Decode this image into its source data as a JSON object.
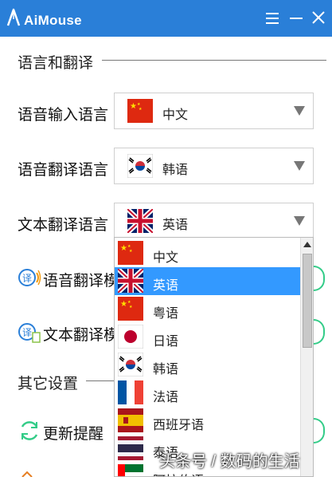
{
  "app": {
    "title": "AiMouse"
  },
  "colors": {
    "titlebar": "#2a7fd8",
    "selected": "#3399ff",
    "toggle": "#33cc88"
  },
  "titlebar": {
    "menu_icon": "hamburger-menu-icon",
    "minimize_icon": "minimize-icon",
    "close_icon": "close-icon"
  },
  "sections": {
    "language": {
      "title": "语言和翻译"
    },
    "other": {
      "title": "其它设置"
    }
  },
  "settings": {
    "voice_input": {
      "label": "语音输入语言",
      "value": "中文",
      "flag": "cn-flag-icon"
    },
    "voice_translate": {
      "label": "语音翻译语言",
      "value": "韩语",
      "flag": "kr-flag-icon"
    },
    "text_translate": {
      "label": "文本翻译语言",
      "value": "英语",
      "flag": "uk-flag-icon"
    },
    "voice_translate_mode": {
      "label": "语音翻译模式",
      "icon": "voice-translate-icon"
    },
    "text_translate_mode": {
      "label": "文本翻译模式",
      "icon": "text-translate-icon"
    },
    "update_reminder": {
      "label": "更新提醒",
      "icon": "refresh-icon"
    }
  },
  "dropdown": {
    "selected_index": 1,
    "items": [
      {
        "label": "中文",
        "flag": "cn-flag-icon"
      },
      {
        "label": "英语",
        "flag": "uk-flag-icon"
      },
      {
        "label": "粤语",
        "flag": "cn-flag-icon"
      },
      {
        "label": "日语",
        "flag": "jp-flag-icon"
      },
      {
        "label": "韩语",
        "flag": "kr-flag-icon"
      },
      {
        "label": "法语",
        "flag": "fr-flag-icon"
      },
      {
        "label": "西班牙语",
        "flag": "es-flag-icon"
      },
      {
        "label": "泰语",
        "flag": "th-flag-icon"
      },
      {
        "label": "阿拉伯语",
        "flag": "ae-flag-icon"
      }
    ]
  },
  "watermark": "头条号 / 数码的生活"
}
